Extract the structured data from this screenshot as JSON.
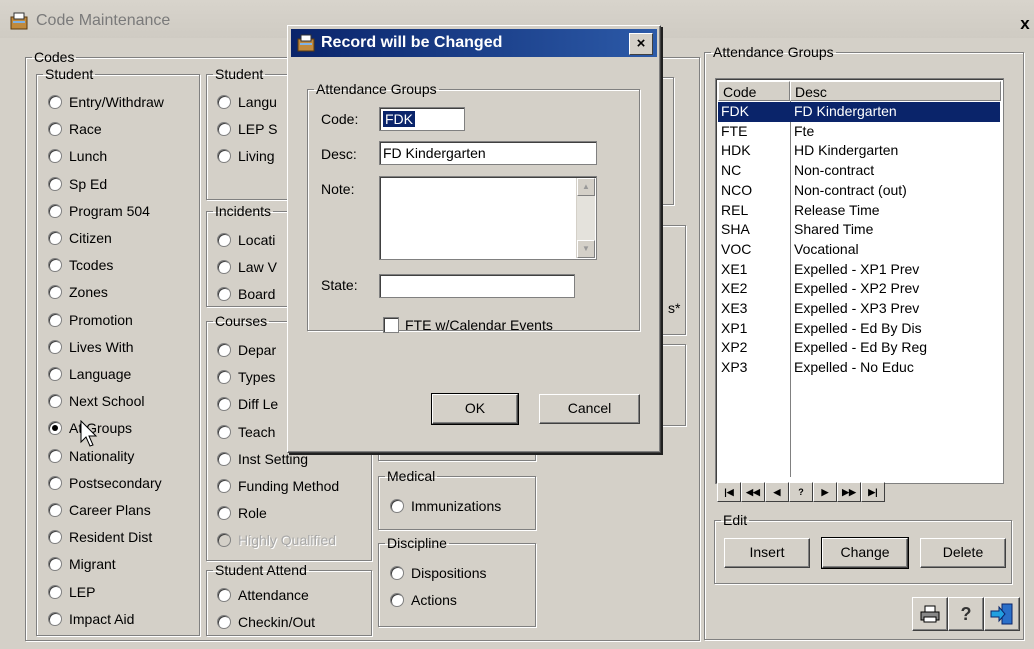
{
  "window": {
    "title": "Code Maintenance",
    "close_glyph": "x"
  },
  "codes": {
    "legend": "Codes",
    "student": {
      "legend": "Student",
      "items": [
        "Entry/Withdraw",
        "Race",
        "Lunch",
        "Sp Ed",
        "Program 504",
        "Citizen",
        "Tcodes",
        "Zones",
        "Promotion",
        "Lives With",
        "Language",
        "Next School",
        "At Groups",
        "Nationality",
        "Postsecondary",
        "Career Plans",
        "Resident Dist",
        "Migrant",
        "LEP",
        "Impact Aid"
      ],
      "selected": "At Groups"
    },
    "student2": {
      "legend": "Student",
      "items": [
        "Langu",
        "LEP S",
        "Living"
      ]
    },
    "incidents": {
      "legend": "Incidents",
      "items": [
        "Locati",
        "Law V",
        "Board"
      ]
    },
    "courses": {
      "legend": "Courses",
      "items": [
        "Depar",
        "Types",
        "Diff Le",
        "Teach",
        "Inst Setting",
        "Funding Method",
        "Role",
        "Highly Qualified"
      ]
    },
    "student_attend": {
      "legend": "Student Attend",
      "items": [
        "Attendance",
        "Checkin/Out"
      ]
    },
    "medical": {
      "legend": "Medical",
      "items": [
        "Immunizations"
      ]
    },
    "discipline": {
      "legend": "Discipline",
      "items": [
        "Dispositions",
        "Actions"
      ]
    },
    "partial_text": "s*"
  },
  "attendance_groups": {
    "legend": "Attendance Groups",
    "headers": [
      "Code",
      "Desc"
    ],
    "rows": [
      [
        "FDK",
        "FD Kindergarten"
      ],
      [
        "FTE",
        "Fte"
      ],
      [
        "HDK",
        "HD Kindergarten"
      ],
      [
        "NC",
        "Non-contract"
      ],
      [
        "NCO",
        "Non-contract (out)"
      ],
      [
        "REL",
        "Release Time"
      ],
      [
        "SHA",
        "Shared Time"
      ],
      [
        "VOC",
        "Vocational"
      ],
      [
        "XE1",
        "Expelled - XP1 Prev"
      ],
      [
        "XE2",
        "Expelled - XP2 Prev"
      ],
      [
        "XE3",
        "Expelled - XP3 Prev"
      ],
      [
        "XP1",
        "Expelled - Ed By Dis"
      ],
      [
        "XP2",
        "Expelled - Ed By Reg"
      ],
      [
        "XP3",
        "Expelled - No Educ"
      ]
    ],
    "selected_row": 0,
    "nav_buttons": [
      "|◀",
      "◀◀",
      "◀",
      "?",
      "▶",
      "▶▶",
      "▶|"
    ]
  },
  "edit": {
    "legend": "Edit",
    "insert": "Insert",
    "change": "Change",
    "delete": "Delete"
  },
  "toolbar_icons": [
    "printer-icon",
    "help-icon",
    "exit-icon"
  ],
  "dialog": {
    "title": "Record will be Changed",
    "close_glyph": "×",
    "group_legend": "Attendance Groups",
    "code_label": "Code:",
    "code_value": "FDK",
    "desc_label": "Desc:",
    "desc_value": "FD Kindergarten",
    "note_label": "Note:",
    "state_label": "State:",
    "state_value": "",
    "fte_label": "FTE w/Calendar Events",
    "ok": "OK",
    "cancel": "Cancel"
  }
}
